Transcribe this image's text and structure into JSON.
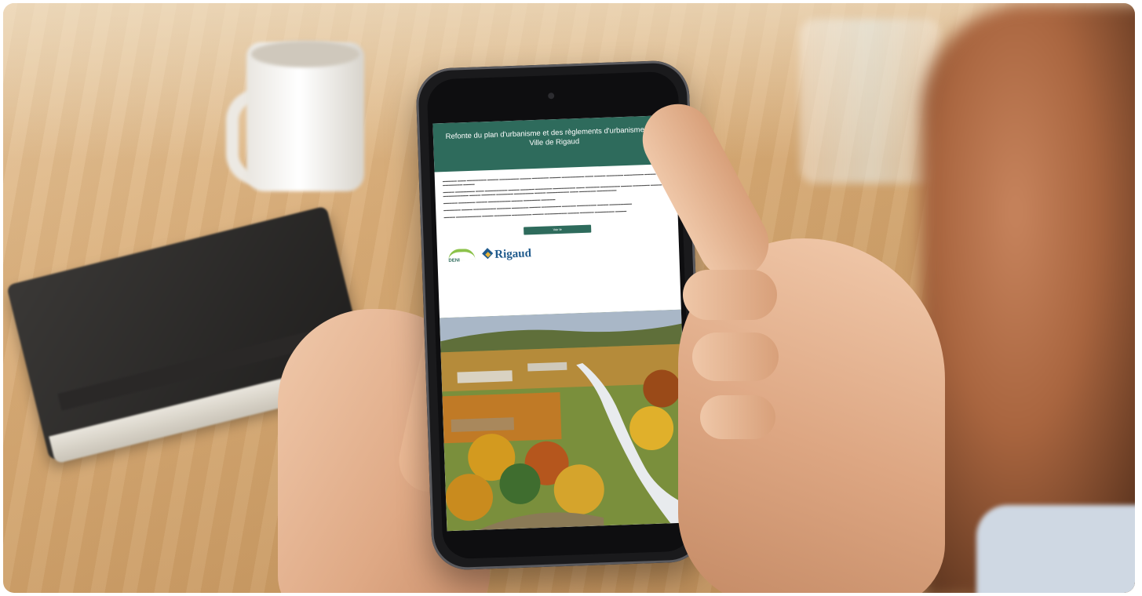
{
  "email": {
    "title": "Refonte du plan d'urbanisme et des règlements d'urbanisme de la Ville de Rigaud",
    "cta_label": "Voir le",
    "logo_deni": "DENI",
    "logo_rigaud": "Rigaud"
  },
  "colors": {
    "header_green": "#2e6b5c",
    "rigaud_blue": "#1f5a8c",
    "deni_green": "#8cc24a"
  }
}
